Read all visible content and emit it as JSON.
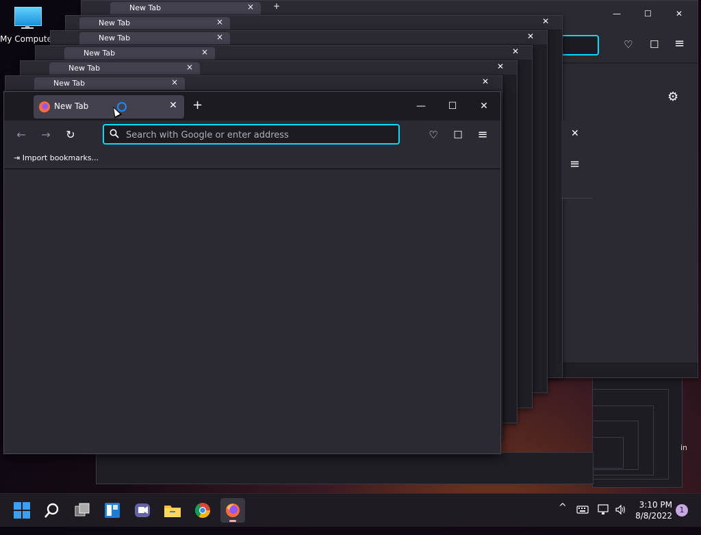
{
  "desktop": {
    "icon_label": "My Computer"
  },
  "background_windows": {
    "tab_label": "New Tab",
    "tab_close": "×",
    "new_tab": "+",
    "minimize": "—",
    "maximize": "☐",
    "close": "✕",
    "right_fragment_text": "in"
  },
  "window": {
    "tab": {
      "title": "New Tab",
      "close": "✕"
    },
    "new_tab_label": "+",
    "controls": {
      "minimize": "—",
      "maximize": "☐",
      "close": "✕"
    },
    "nav": {
      "back": "←",
      "forward": "→",
      "reload": "↻"
    },
    "urlbar": {
      "placeholder": "Search with Google or enter address"
    },
    "toolbar": {
      "pocket": "♡",
      "extensions": "☐",
      "menu": "≡"
    },
    "bookmarks": {
      "import_label": "Import bookmarks..."
    }
  },
  "right_panel": {
    "close": "✕",
    "menu": "≡",
    "settings": "⚙"
  },
  "taskbar": {
    "clock_time": "3:10 PM",
    "clock_date": "8/8/2022",
    "notification_count": "1",
    "tray_chevron": "^"
  },
  "colors": {
    "accent": "#00ddff",
    "spinner": "#1f8bff",
    "toolbar": "#2b2a33",
    "frame": "#1c1b22"
  }
}
